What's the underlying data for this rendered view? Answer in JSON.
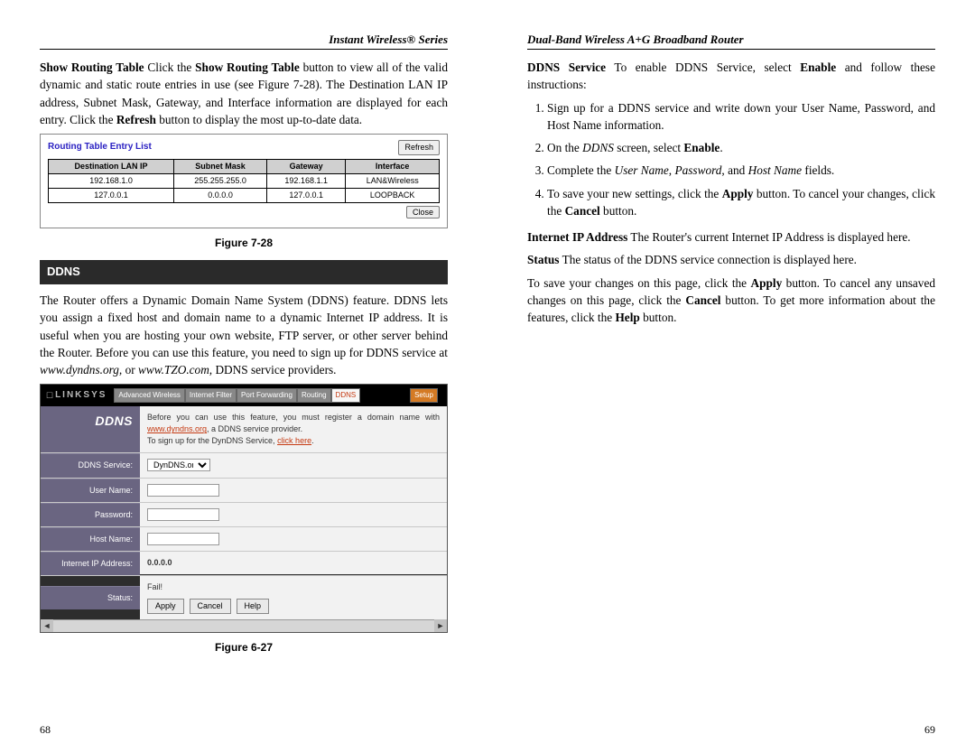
{
  "left": {
    "header": "Instant Wireless® Series",
    "p1_a": "Show Routing Table",
    "p1_b": "  Click the ",
    "p1_c": "Show Routing Table",
    "p1_d": " button to view all of the valid dynamic and static route entries in use (see Figure 7-28). The Destination LAN IP address, Subnet Mask, Gateway, and Interface information are displayed for each entry. Click the ",
    "p1_e": "Refresh",
    "p1_f": " button to display the most up-to-date data.",
    "routing": {
      "title": "Routing Table Entry List",
      "refresh": "Refresh",
      "close": "Close",
      "headers": [
        "Destination LAN IP",
        "Subnet Mask",
        "Gateway",
        "Interface"
      ],
      "rows": [
        [
          "192.168.1.0",
          "255.255.255.0",
          "192.168.1.1",
          "LAN&Wireless"
        ],
        [
          "127.0.0.1",
          "0.0.0.0",
          "127.0.0.1",
          "LOOPBACK"
        ]
      ]
    },
    "fig728": "Figure 7-28",
    "section": "DDNS",
    "p2_a": "The Router offers a Dynamic Domain Name System (DDNS) feature. DDNS lets you assign a fixed host and domain name to a dynamic Internet IP address. It is useful when you are hosting your own website, FTP server, or other server behind the Router. Before you can use this feature, you need to sign up for DDNS service at ",
    "p2_b": "www.dyndns.org,",
    "p2_c": " or ",
    "p2_d": "www.TZO.com,",
    "p2_e": " DDNS service providers.",
    "ddns": {
      "brand": "LINKSYS",
      "tabs": [
        "Advanced Wireless",
        "Internet Filter",
        "Port Forwarding",
        "Routing"
      ],
      "tab_active": "DDNS",
      "tab_setup": "Setup",
      "title": "DDNS",
      "note": "Before you can use this feature, you must register a domain name with ",
      "note_link": "www.dyndns.org",
      "note2": ", a DDNS service provider.",
      "note3": "To sign up for the DynDNS Service, ",
      "note3_link": "click here",
      "labels": {
        "service": "DDNS Service:",
        "user": "User Name:",
        "pass": "Password:",
        "host": "Host Name:",
        "ip": "Internet IP Address:",
        "status": "Status:"
      },
      "service_value": "DynDNS.org",
      "ip_value": "0.0.0.0",
      "status_value": "Fail!",
      "btn_apply": "Apply",
      "btn_cancel": "Cancel",
      "btn_help": "Help"
    },
    "fig627": "Figure 6-27",
    "pagenum": "68"
  },
  "right": {
    "header": "Dual-Band Wireless A+G Broadband Router",
    "p1_a": "DDNS Service",
    "p1_b": "  To enable DDNS Service, select ",
    "p1_c": "Enable",
    "p1_d": " and follow these instructions:",
    "steps": {
      "s1": "Sign up for a DDNS service and write down your User Name, Password, and Host Name information.",
      "s2_a": "On the ",
      "s2_b": "DDNS",
      "s2_c": " screen, select ",
      "s2_d": "Enable",
      "s2_e": ".",
      "s3_a": "Complete the ",
      "s3_b": "User Name",
      "s3_c": ", ",
      "s3_d": "Password",
      "s3_e": ", and ",
      "s3_f": "Host Name",
      "s3_g": " fields.",
      "s4_a": "To save your new settings, click the ",
      "s4_b": "Apply",
      "s4_c": " button. To cancel your changes, click the ",
      "s4_d": "Cancel",
      "s4_e": " button."
    },
    "p2_a": "Internet IP Address",
    "p2_b": "  The Router's current Internet IP Address is displayed here.",
    "p3_a": "Status",
    "p3_b": "  The status of the DDNS service connection is displayed here.",
    "p4_a": "To save your changes on this page, click the ",
    "p4_b": "Apply",
    "p4_c": " button. To cancel any unsaved changes on this page, click the ",
    "p4_d": "Cancel",
    "p4_e": " button. To get more information about the features, click the ",
    "p4_f": "Help",
    "p4_g": " button.",
    "pagenum": "69"
  }
}
